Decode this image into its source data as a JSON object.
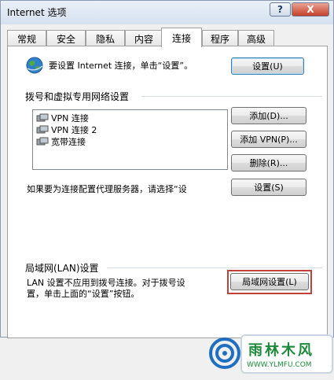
{
  "window": {
    "title": "Internet 选项",
    "help_label": "?",
    "close_label": "X"
  },
  "tabs": [
    {
      "label": "常规"
    },
    {
      "label": "安全"
    },
    {
      "label": "隐私"
    },
    {
      "label": "内容"
    },
    {
      "label": "连接"
    },
    {
      "label": "程序"
    },
    {
      "label": "高级"
    }
  ],
  "active_tab": "连接",
  "connection": {
    "setup_text": "要设置 Internet 连接，单击“设置”。",
    "setup_button": "设置(U)"
  },
  "dialup": {
    "group_label": "拨号和虚拟专用网络设置",
    "items": [
      {
        "label": "VPN 连接"
      },
      {
        "label": "VPN 连接 2"
      },
      {
        "label": "宽带连接"
      }
    ],
    "add_button": "添加(D)...",
    "add_vpn_button": "添加 VPN(P)...",
    "delete_button": "删除(R)...",
    "proxy_text": "如果要为连接配置代理服务器，请选择“设",
    "settings_button": "设置(S)"
  },
  "lan": {
    "group_label": "局域网(LAN)设置",
    "desc_line1": "LAN 设置不应用到拨号连接。对于拨号设",
    "desc_line2": "置，单击上面的“设置”按钮。",
    "lan_settings_button": "局域网设置(L)"
  },
  "watermark": {
    "brand": "雨林木风",
    "url": "WWW.YLMFU.COM"
  },
  "colors": {
    "highlight": "#c2403a",
    "accent": "#3c7fb1"
  }
}
